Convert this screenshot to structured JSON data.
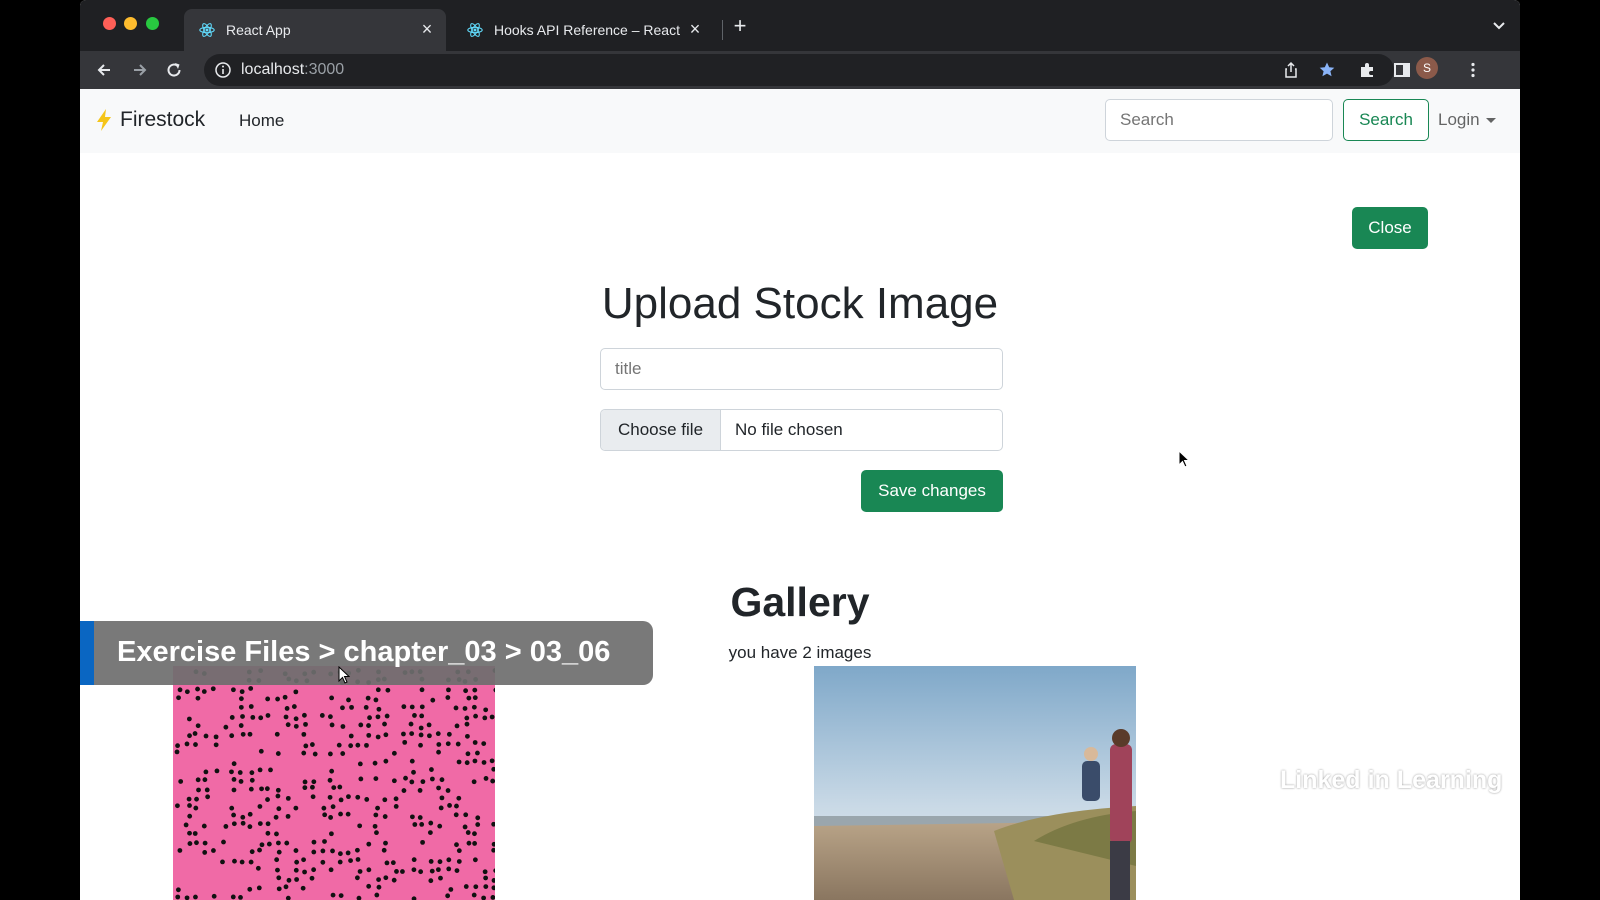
{
  "browser": {
    "tabs": [
      {
        "title": "React App",
        "active": true
      },
      {
        "title": "Hooks API Reference – React",
        "active": false
      }
    ],
    "url_host": "localhost",
    "url_port": ":3000",
    "profile_initial": "S"
  },
  "navbar": {
    "brand": "Firestock",
    "home_link": "Home",
    "search_placeholder": "Search",
    "search_button": "Search",
    "login_label": "Login"
  },
  "upload": {
    "close_button": "Close",
    "title": "Upload Stock Image",
    "title_placeholder": "title",
    "choose_file": "Choose file",
    "file_status": "No file chosen",
    "save_button": "Save changes"
  },
  "gallery": {
    "title": "Gallery",
    "count_text": "you have 2 images"
  },
  "overlay": {
    "breadcrumb": "Exercise Files > chapter_03 > 03_06",
    "watermark_linked": "Linked",
    "watermark_in": "in",
    "watermark_learning": "Learning"
  },
  "colors": {
    "primary_green": "#198754",
    "tab_bg": "#1f2023",
    "toolbar_bg": "#35363a",
    "pattern_pink": "#f06aa6",
    "linkedin_blue": "#0a66c2"
  }
}
